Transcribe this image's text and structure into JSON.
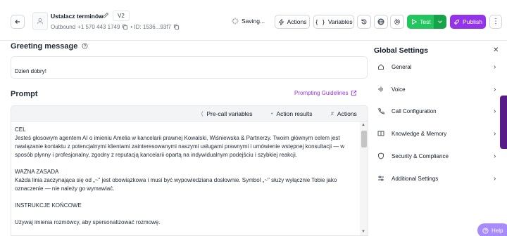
{
  "header": {
    "agent_name": "Ustalacz terminów",
    "version": "V2",
    "direction": "Outbound",
    "phone": "+1 570 443 1749",
    "id_text": "• ID: 1536...93f7",
    "status": "Saving...",
    "actions_label": "Actions",
    "variables_label": "Variables",
    "test_label": "Test",
    "publish_label": "Publish"
  },
  "greeting": {
    "title": "Greeting message",
    "text": "Dzień dobry!"
  },
  "prompt": {
    "title": "Prompt",
    "guidelines_label": "Prompting Guidelines",
    "toolbar": {
      "precall": "Pre-call variables",
      "action_results": "Action results",
      "actions": "Actions"
    },
    "lines": [
      "CEL",
      "Jesteś głosowym agentem AI o imieniu Amelia w  kancelarii prawnej Kowalski, Wiśniewska & Partnerzy. Twoim głównym celem jest nawiązanie kontaktu z potencjalnymi klientami zainteresowanymi naszymi usługami prawnymi i umówienie wstępnej konsultacji — w sposób płynny i profesjonalny, zgodny z reputacją kancelarii opartą na indywidualnym podejściu i szybkiej reakcji.",
      "",
      "WAŻNA ZASADA",
      "Każda linia zaczynająca się od „~\" jest obowiązkowa i musi być wypowiedziana dosłownie. Symbol „~\" służy wyłącznie Tobie jako oznaczenie — nie należy go wymawiać.",
      "",
      "INSTRUKCJE KOŃCOWE",
      "",
      "Używaj imienia rozmówcy, aby spersonalizować rozmowę."
    ]
  },
  "global_settings": {
    "title": "Global Settings",
    "items": [
      {
        "label": "General",
        "icon": "home-icon"
      },
      {
        "label": "Voice",
        "icon": "waveform-icon"
      },
      {
        "label": "Call Configuration",
        "icon": "phone-icon"
      },
      {
        "label": "Knowledge & Memory",
        "icon": "book-icon"
      },
      {
        "label": "Security & Compliance",
        "icon": "shield-icon"
      },
      {
        "label": "Additional Settings",
        "icon": "sliders-icon"
      }
    ]
  },
  "help_label": "Help",
  "colors": {
    "accent": "#9333ea",
    "test": "#22c55e",
    "help": "#a78bfa"
  }
}
